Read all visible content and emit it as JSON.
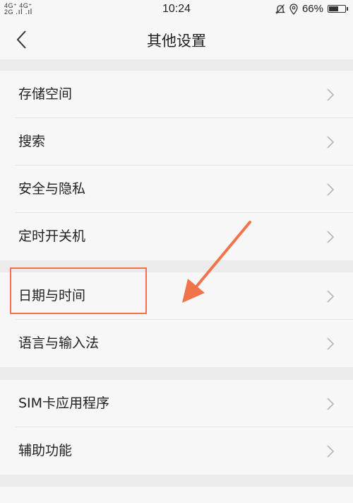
{
  "status_bar": {
    "signal_top": "4G⁺ 4G⁺",
    "signal_bottom": "2G",
    "time": "10:24",
    "battery": "66%",
    "battery_level": 0.66
  },
  "nav": {
    "title": "其他设置",
    "back_icon": "chevron-left-icon"
  },
  "groups": [
    {
      "items": [
        {
          "label": "存储空间"
        },
        {
          "label": "搜索"
        },
        {
          "label": "安全与隐私"
        },
        {
          "label": "定时开关机"
        }
      ]
    },
    {
      "items": [
        {
          "label": "日期与时间"
        },
        {
          "label": "语言与输入法"
        }
      ]
    },
    {
      "items": [
        {
          "label": "SIM卡应用程序"
        },
        {
          "label": "辅助功能"
        }
      ]
    }
  ],
  "annotation": {
    "color": "#f0734a",
    "highlighted_item": "日期与时间"
  },
  "colors": {
    "background": "#ebebeb",
    "panel": "#f7f7f7",
    "chevron": "#b5b5b5"
  }
}
